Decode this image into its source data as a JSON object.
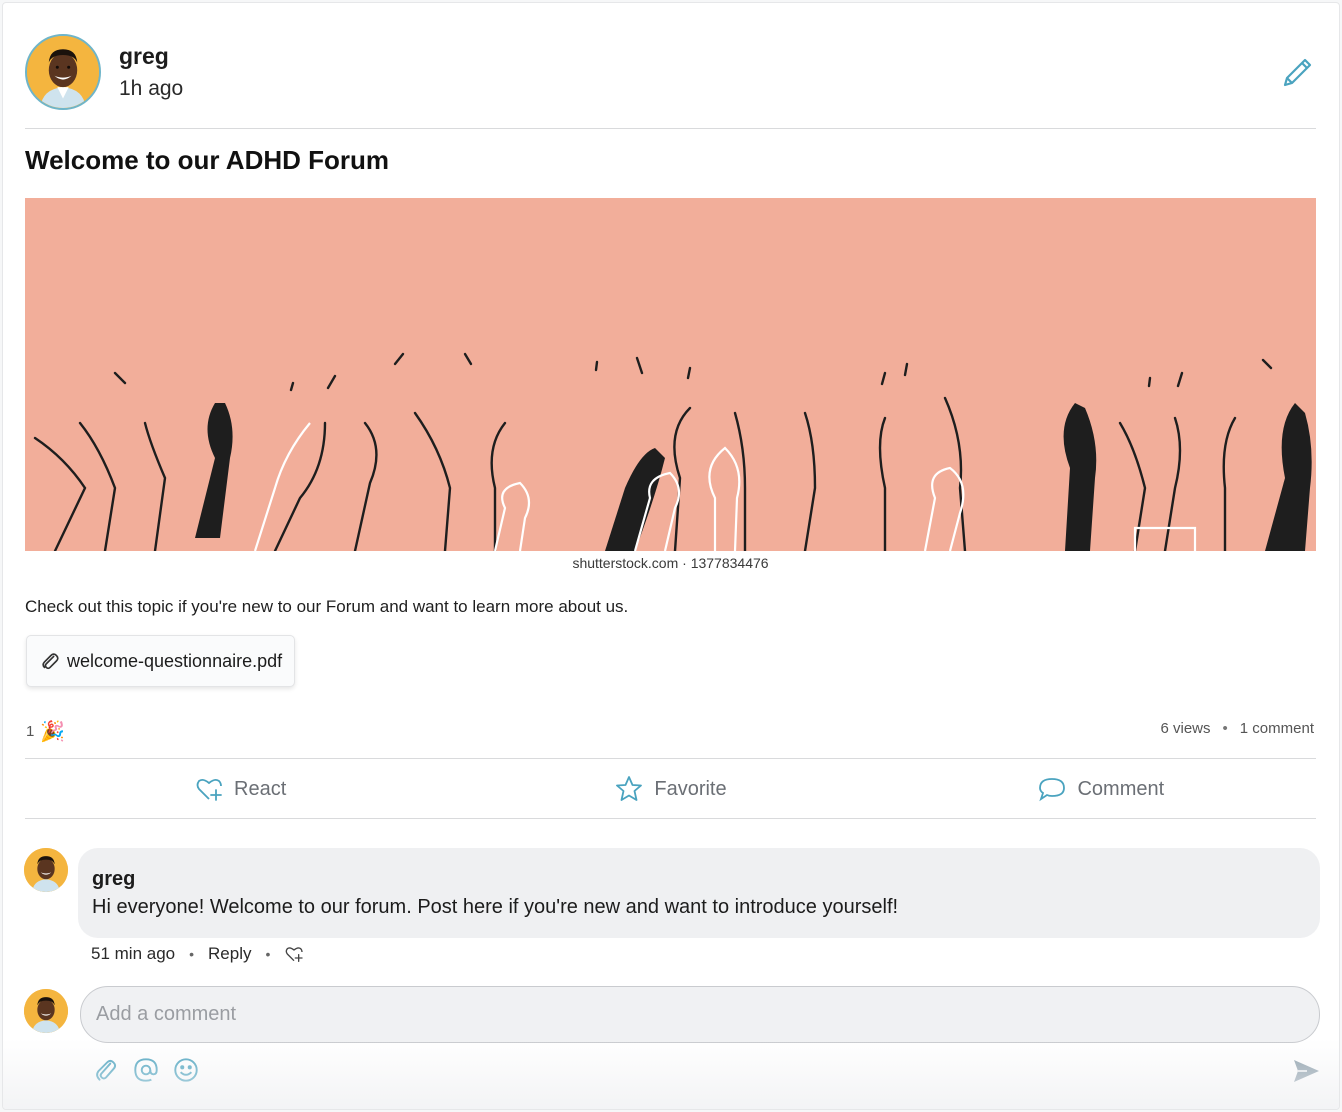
{
  "post": {
    "author": "greg",
    "time": "1h ago",
    "title": "Welcome to our ADHD Forum",
    "image_credit": "shutterstock.com · 1377834476",
    "body": "Check out this topic if you're new to our Forum and want to learn more about us.",
    "attachment": "welcome-questionnaire.pdf",
    "reaction_count": "1",
    "reaction_icon": "party-popper-icon",
    "views": "6 views",
    "comments_count": "1 comment"
  },
  "actions": {
    "react": "React",
    "favorite": "Favorite",
    "comment": "Comment"
  },
  "comment": {
    "author": "greg",
    "text": "Hi everyone! Welcome to our forum. Post here if you're new and want to introduce yourself!",
    "time": "51 min ago",
    "reply": "Reply"
  },
  "composer": {
    "placeholder": "Add a comment"
  },
  "colors": {
    "accent": "#4aa3bf",
    "banner_bg": "#f2ae9a",
    "avatar_bg": "#f4b53f"
  }
}
